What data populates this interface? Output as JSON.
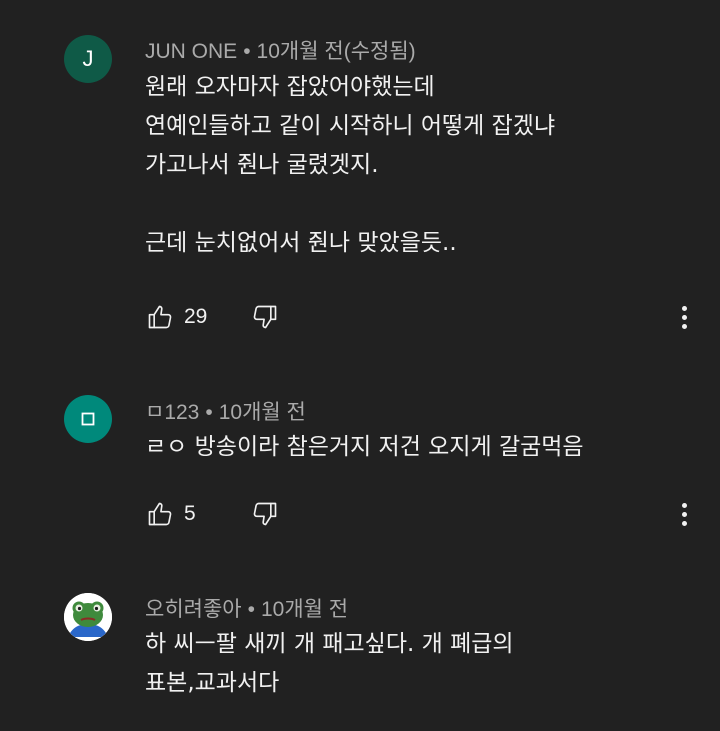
{
  "comments": [
    {
      "avatar_letter": "J",
      "avatar_color": "#0f5a47",
      "author": "JUN ONE",
      "time": "10개월 전(수정됨)",
      "text": "원래 오자마자 잡았어야했는데\n연예인들하고 같이 시작하니 어떻게 잡겠냐\n가고나서 줜나 굴렸겟지.\n\n근데 눈치없어서 줜나 맞았을듯..",
      "likes": "29"
    },
    {
      "avatar_letter": "ㅁ",
      "avatar_color": "#00897b",
      "author": "ㅁ123",
      "time": "10개월 전",
      "text": "ㄹㅇ 방송이라 참은거지 저건 오지게 갈굼먹음",
      "likes": "5"
    },
    {
      "avatar_letter": "",
      "avatar_color": "#ffffff",
      "author": "오히려좋아",
      "time": "10개월 전",
      "text": "하 씨ㅡ팔 새끼 개 패고싶다. 개 폐급의\n표본,교과서다",
      "likes": ""
    }
  ],
  "separator": "•",
  "icons": {
    "like": "thumbs-up-icon",
    "dislike": "thumbs-down-icon",
    "more": "more-vert-icon"
  }
}
